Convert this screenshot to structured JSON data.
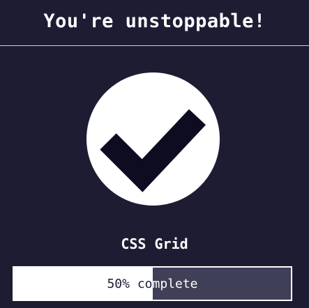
{
  "header": {
    "title": "You're unstoppable!"
  },
  "status": {
    "icon": "checkmark-icon",
    "colors": {
      "background": "#1d1c33",
      "circle": "#ffffff",
      "check": "#0d0c21"
    }
  },
  "skill": {
    "name": "CSS Grid"
  },
  "progress": {
    "percent": 50,
    "label": "50% complete",
    "fill_color": "#ffffff",
    "track_color": "#3f3f57"
  }
}
